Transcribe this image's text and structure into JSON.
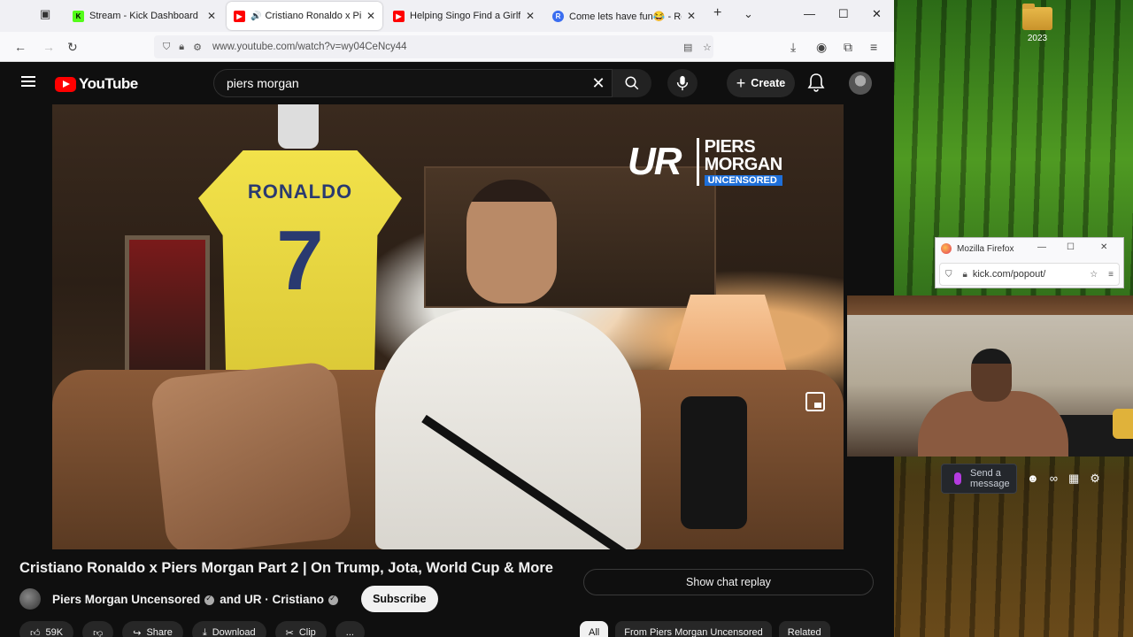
{
  "desktop": {
    "folder_label": "2023"
  },
  "browser": {
    "tabs": [
      {
        "title": "Stream - Kick Dashboard",
        "fav_color": "#53fc18",
        "fav_glyph": "K",
        "active": false
      },
      {
        "title": "Cristiano Ronaldo x Piers M",
        "fav_color": "#ff0000",
        "fav_glyph": "▶",
        "active": true,
        "audio": true
      },
      {
        "title": "Helping Singo Find a Girlfriend",
        "fav_color": "#ff0000",
        "fav_glyph": "▶",
        "active": false
      },
      {
        "title": "Come lets have fun😂 - Restr",
        "fav_color": "#3a6df0",
        "fav_glyph": "R",
        "active": false
      }
    ],
    "new_tab_label": "+",
    "url": "www.youtube.com/watch?v=wy04CeNcy44",
    "url_domain": "youtube.com"
  },
  "youtube": {
    "logo_text": "YouTube",
    "search_value": "piers morgan",
    "create_label": "Create",
    "video": {
      "overlay_brand_mark": "UR",
      "overlay_brand_line1": "PIERS",
      "overlay_brand_line2": "MORGAN",
      "overlay_brand_tag": "UNCENSORED",
      "jersey_name": "RONALDO",
      "jersey_number": "7"
    },
    "title": "Cristiano Ronaldo x Piers Morgan Part 2 | On Trump, Jota, World Cup & More",
    "channel_primary": "Piers Morgan Uncensored",
    "channel_joiner": "and UR · Cristiano",
    "subscribe_label": "Subscribe",
    "chat_replay_label": "Show chat replay",
    "actions": [
      "59K",
      "",
      "Share",
      "Download",
      "Clip",
      "..."
    ],
    "chips": [
      "All",
      "From Piers Morgan Uncensored",
      "Related"
    ]
  },
  "popout": {
    "title": "Mozilla Firefox",
    "url": "kick.com/popout/"
  },
  "kick": {
    "chat_placeholder": "Send a message"
  }
}
